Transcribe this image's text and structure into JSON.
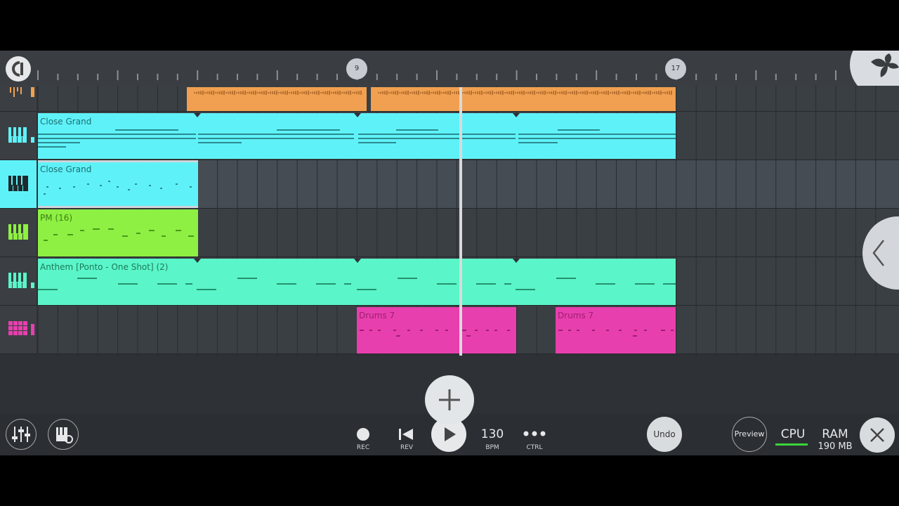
{
  "ruler": {
    "markers": [
      "9",
      "17"
    ]
  },
  "tracks": [
    {
      "id": "audio"
    },
    {
      "id": "close-grand-1"
    },
    {
      "id": "close-grand-2",
      "selected": true
    },
    {
      "id": "pm"
    },
    {
      "id": "anthem"
    },
    {
      "id": "drums"
    }
  ],
  "clips": {
    "close_grand_a": "Close Grand",
    "close_grand_b": "Close Grand",
    "pm": "PM (16)",
    "anthem": "Anthem [Ponto - One Shot] (2)",
    "drums_a": "Drums 7",
    "drums_b": "Drums 7"
  },
  "colors": {
    "audio": "#f0a050",
    "close_grand": "#5ef2f8",
    "pm": "#8ef043",
    "anthem": "#5af5c8",
    "drums": "#e83fae",
    "background": "#2e3236"
  },
  "toolbar": {
    "rec": "REC",
    "rev": "REV",
    "bpm_value": "130",
    "bpm_label": "BPM",
    "ctrl": "CTRL",
    "undo": "Undo",
    "preview": "Preview",
    "cpu": "CPU",
    "ram": "RAM",
    "ram_value": "190 MB"
  },
  "icons": [
    "snap-icon",
    "fl-logo-icon",
    "mixer-icon",
    "piano-settings-icon",
    "record-icon",
    "rewind-icon",
    "play-icon",
    "more-icon",
    "close-icon",
    "add-icon",
    "collapse-icon"
  ]
}
